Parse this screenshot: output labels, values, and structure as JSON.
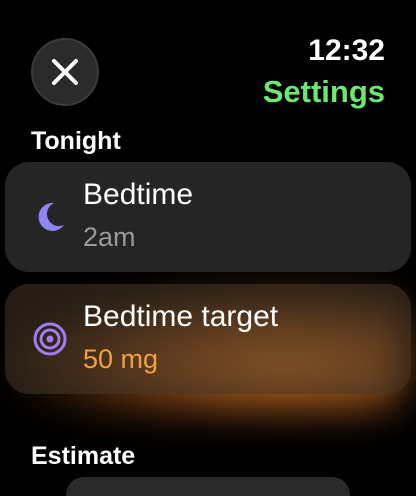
{
  "header": {
    "close_icon": "close-icon",
    "time": "12:32",
    "title": "Settings",
    "title_color": "#6ce86f"
  },
  "sections": {
    "tonight": {
      "heading": "Tonight",
      "items": [
        {
          "icon": "moon-icon",
          "icon_color": "#8f86f5",
          "label": "Bedtime",
          "value": "2am",
          "value_color": "#9a9a9a"
        },
        {
          "icon": "target-icon",
          "icon_color": "#a27cf0",
          "label": "Bedtime target",
          "value": "50 mg",
          "value_color": "#f3a040"
        }
      ]
    },
    "estimate": {
      "heading": "Estimate"
    }
  }
}
